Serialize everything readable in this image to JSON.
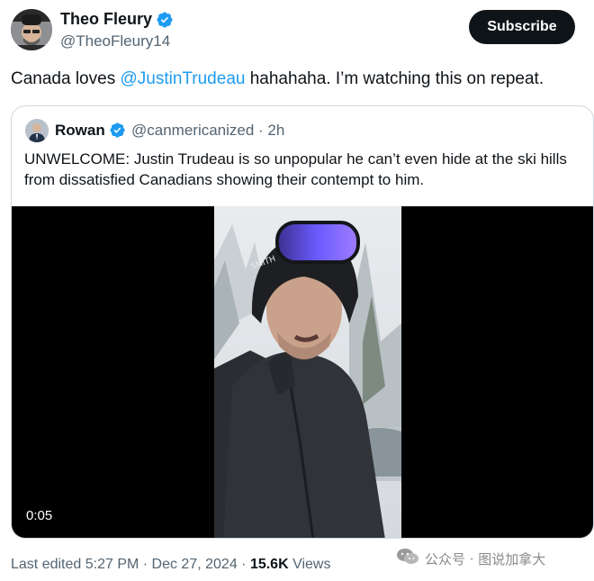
{
  "author": {
    "name": "Theo Fleury",
    "handle": "@TheoFleury14",
    "verified": true
  },
  "subscribe_label": "Subscribe",
  "more_icon": "more-dots-icon",
  "tweet": {
    "before": "Canada loves ",
    "mention": "@JustinTrudeau",
    "after": " hahahaha. I’m watching this on repeat."
  },
  "quoted": {
    "name": "Rowan",
    "handle_time": "@canmericanized · 2h",
    "text": "UNWELCOME: Justin Trudeau is so unpopular he can’t even hide at the ski hills from dissatisfied Canadians showing their contempt to him.",
    "video_duration": "0:05"
  },
  "footer": {
    "edited": "Last edited 5:27 PM · Dec 27, 2024 · ",
    "views_count": "15.6K",
    "views_label": " Views"
  },
  "watermark": {
    "text": "公众号 · 图说加拿大"
  },
  "colors": {
    "accent": "#1d9bf0",
    "text": "#0f1419",
    "secondary": "#536471",
    "border": "#cfd9de"
  }
}
